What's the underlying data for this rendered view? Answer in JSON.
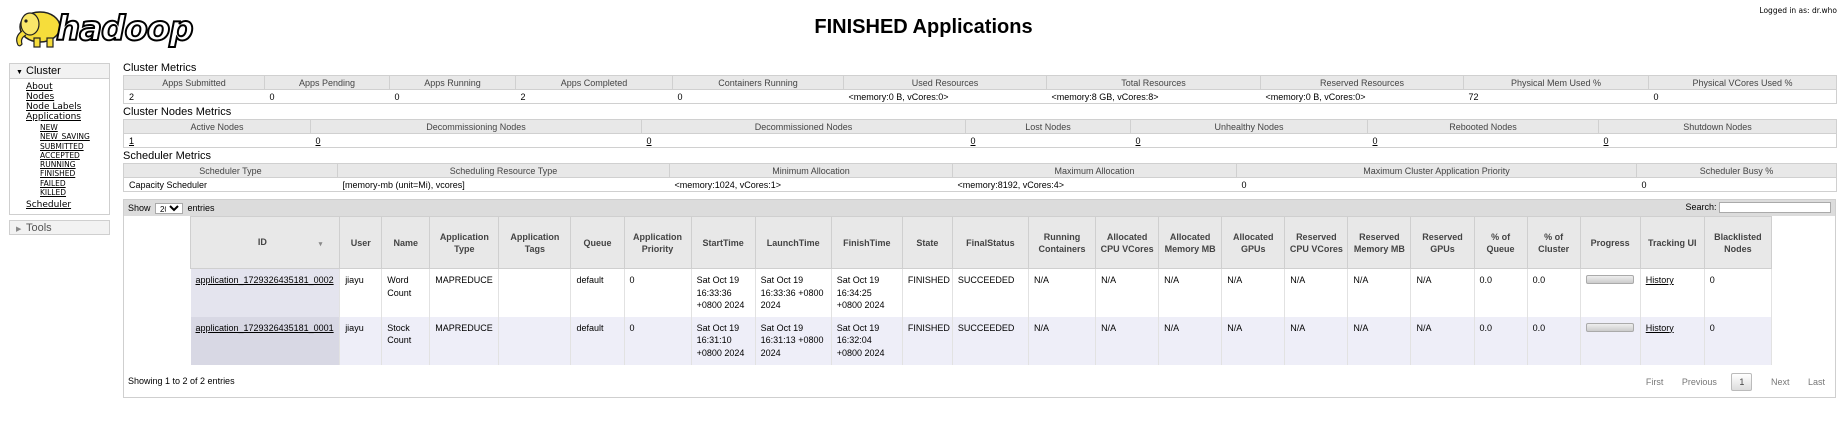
{
  "header": {
    "logo_text": "hadoop",
    "title": "FINISHED Applications",
    "logged_in": "Logged in as: dr.who"
  },
  "sidebar": {
    "cluster_label": "Cluster",
    "items": [
      "About",
      "Nodes",
      "Node Labels",
      "Applications"
    ],
    "app_states": [
      "NEW",
      "NEW_SAVING",
      "SUBMITTED",
      "ACCEPTED",
      "RUNNING",
      "FINISHED",
      "FAILED",
      "KILLED"
    ],
    "scheduler_label": "Scheduler",
    "tools_label": "Tools"
  },
  "cluster_metrics": {
    "title": "Cluster Metrics",
    "headers": [
      "Apps Submitted",
      "Apps Pending",
      "Apps Running",
      "Apps Completed",
      "Containers Running",
      "Used Resources",
      "Total Resources",
      "Reserved Resources",
      "Physical Mem Used %",
      "Physical VCores Used %"
    ],
    "values": [
      "2",
      "0",
      "0",
      "2",
      "0",
      "<memory:0 B, vCores:0>",
      "<memory:8 GB, vCores:8>",
      "<memory:0 B, vCores:0>",
      "72",
      "0"
    ]
  },
  "cluster_nodes_metrics": {
    "title": "Cluster Nodes Metrics",
    "headers": [
      "Active Nodes",
      "Decommissioning Nodes",
      "Decommissioned Nodes",
      "Lost Nodes",
      "Unhealthy Nodes",
      "Rebooted Nodes",
      "Shutdown Nodes"
    ],
    "values": [
      "1",
      "0",
      "0",
      "0",
      "0",
      "0",
      "0"
    ]
  },
  "scheduler_metrics": {
    "title": "Scheduler Metrics",
    "headers": [
      "Scheduler Type",
      "Scheduling Resource Type",
      "Minimum Allocation",
      "Maximum Allocation",
      "Maximum Cluster Application Priority",
      "Scheduler Busy %"
    ],
    "values": [
      "Capacity Scheduler",
      "[memory-mb (unit=Mi), vcores]",
      "<memory:1024, vCores:1>",
      "<memory:8192, vCores:4>",
      "0",
      "0"
    ]
  },
  "apps_table": {
    "show_label": "Show",
    "page_size": "20",
    "entries_label": "entries",
    "search_label": "Search:",
    "headers": [
      "ID",
      "User",
      "Name",
      "Application Type",
      "Application Tags",
      "Queue",
      "Application Priority",
      "StartTime",
      "LaunchTime",
      "FinishTime",
      "State",
      "FinalStatus",
      "Running Containers",
      "Allocated CPU VCores",
      "Allocated Memory MB",
      "Allocated GPUs",
      "Reserved CPU VCores",
      "Reserved Memory MB",
      "Reserved GPUs",
      "% of Queue",
      "% of Cluster",
      "Progress",
      "Tracking UI",
      "Blacklisted Nodes"
    ],
    "rows": [
      {
        "id": "application_1729326435181_0002",
        "user": "jiayu",
        "name": "Word Count",
        "type": "MAPREDUCE",
        "tags": "",
        "queue": "default",
        "priority": "0",
        "start": "Sat Oct 19 16:33:36 +0800 2024",
        "launch": "Sat Oct 19 16:33:36 +0800 2024",
        "finish": "Sat Oct 19 16:34:25 +0800 2024",
        "state": "FINISHED",
        "final_status": "SUCCEEDED",
        "running_containers": "N/A",
        "alloc_vcores": "N/A",
        "alloc_mem": "N/A",
        "alloc_gpus": "N/A",
        "res_vcores": "N/A",
        "res_mem": "N/A",
        "res_gpus": "N/A",
        "pct_queue": "0.0",
        "pct_cluster": "0.0",
        "progress": 1.0,
        "tracking": "History",
        "blacklisted": "0"
      },
      {
        "id": "application_1729326435181_0001",
        "user": "jiayu",
        "name": "Stock Count",
        "type": "MAPREDUCE",
        "tags": "",
        "queue": "default",
        "priority": "0",
        "start": "Sat Oct 19 16:31:10 +0800 2024",
        "launch": "Sat Oct 19 16:31:13 +0800 2024",
        "finish": "Sat Oct 19 16:32:04 +0800 2024",
        "state": "FINISHED",
        "final_status": "SUCCEEDED",
        "running_containers": "N/A",
        "alloc_vcores": "N/A",
        "alloc_mem": "N/A",
        "alloc_gpus": "N/A",
        "res_vcores": "N/A",
        "res_mem": "N/A",
        "res_gpus": "N/A",
        "pct_queue": "0.0",
        "pct_cluster": "0.0",
        "progress": 1.0,
        "tracking": "History",
        "blacklisted": "0"
      }
    ],
    "showing_text": "Showing 1 to 2 of 2 entries",
    "pager": {
      "first": "First",
      "previous": "Previous",
      "current": "1",
      "next": "Next",
      "last": "Last"
    }
  }
}
